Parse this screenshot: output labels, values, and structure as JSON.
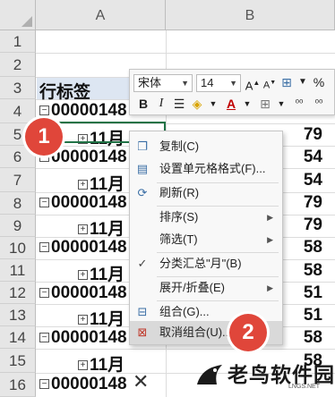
{
  "columns": [
    "A",
    "B"
  ],
  "rows": [
    "1",
    "2",
    "3",
    "4",
    "5",
    "6",
    "7",
    "8",
    "9",
    "10",
    "11",
    "12",
    "13",
    "14",
    "15",
    "16"
  ],
  "cells": {
    "a3": "行标签",
    "a4": "00000148",
    "a5": "11月",
    "a6": "00000148",
    "a7": "11月",
    "a8": "00000148",
    "a9": "11月",
    "a10": "00000148",
    "a11": "11月",
    "a12": "00000148",
    "a13": "11月",
    "a14": "00000148",
    "a15": "11月",
    "a16": "00000148"
  },
  "col_b": {
    "b5": "79",
    "b6": "54",
    "b7": "54",
    "b8": "79",
    "b9": "79",
    "b10": "58",
    "b11": "58",
    "b12": "51",
    "b13": "51",
    "b14": "58",
    "b15": "58"
  },
  "toolbar": {
    "font_name": "宋体",
    "font_size": "14",
    "percent": "%",
    "bold": "B",
    "italic": "I"
  },
  "menu": {
    "items": [
      {
        "label": "复制(C)",
        "icon": "copy-icon"
      },
      {
        "label": "设置单元格格式(F)...",
        "icon": "format-cells-icon"
      },
      {
        "label": "刷新(R)",
        "icon": "refresh-icon"
      },
      {
        "label": "排序(S)",
        "icon": ""
      },
      {
        "label": "筛选(T)",
        "icon": ""
      },
      {
        "label": "分类汇总\"月\"(B)",
        "icon": "check-icon"
      },
      {
        "label": "展开/折叠(E)",
        "icon": ""
      },
      {
        "label": "组合(G)...",
        "icon": "group-icon"
      },
      {
        "label": "取消组合(U)...",
        "icon": "ungroup-icon"
      }
    ]
  },
  "badges": {
    "one": "1",
    "two": "2"
  },
  "watermark": {
    "text": "老鸟软件园",
    "sub": "LNGS.NET"
  },
  "colors": {
    "badge": "#e0463a",
    "selection": "#217346",
    "accent": "#3a6ea5"
  }
}
